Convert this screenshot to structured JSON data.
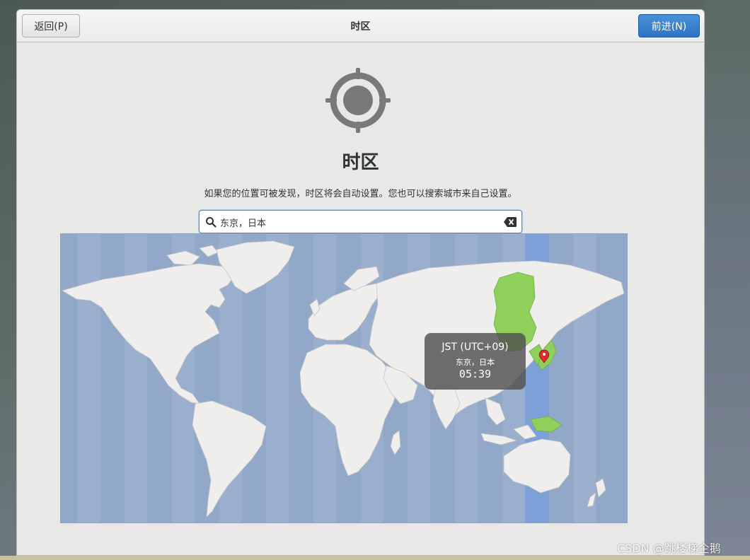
{
  "window": {
    "title": "时区",
    "back_label": "返回(P)",
    "next_label": "前进(N)"
  },
  "page": {
    "icon": "location-target-icon",
    "title": "时区",
    "description": "如果您的位置可被发现，时区将会自动设置。您也可以搜索城市来自己设置。"
  },
  "search": {
    "value": "东京，日本",
    "icon": "search-icon",
    "clear_icon": "clear-text-icon"
  },
  "map": {
    "selected_zone_color": "#7ea0d8",
    "selected_region_color": "#8ed05a",
    "ocean_color": "#92a8c8",
    "land_color": "#f0eeec",
    "pin_color": "#e02b2b"
  },
  "tooltip": {
    "abbr": "JST (UTC+09)",
    "city": "东京，日本",
    "time": "05:39"
  },
  "watermark": "CSDN @跳楼梯企鹅",
  "colors": {
    "accent": "#3584e4",
    "text": "#2e3436",
    "window_bg": "#e8e8e7"
  }
}
